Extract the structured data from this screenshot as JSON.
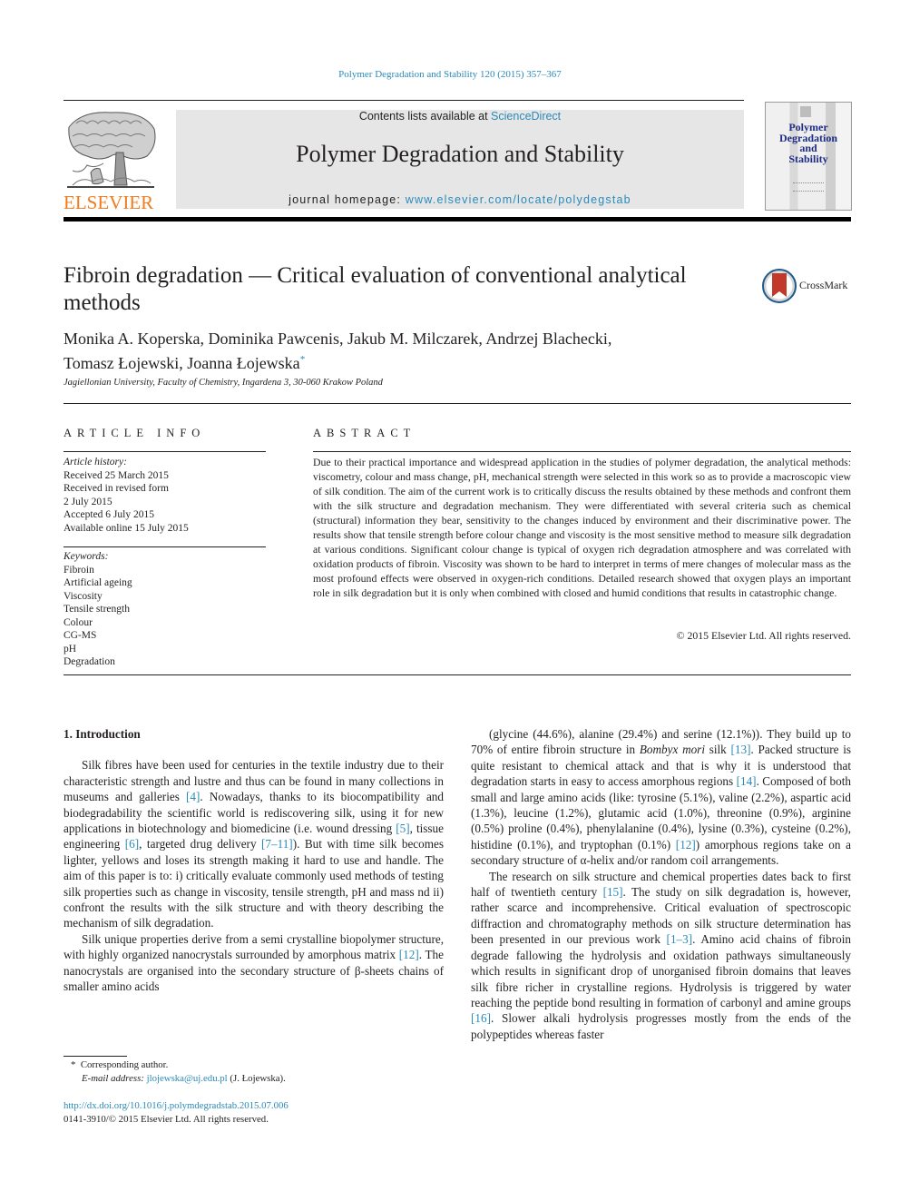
{
  "header": {
    "citation": "Polymer Degradation and Stability 120 (2015) 357–367",
    "publisher_logo_text": "ELSEVIER",
    "contents_prefix": "Contents lists available at ",
    "contents_link": "ScienceDirect",
    "journal_name": "Polymer Degradation and Stability",
    "homepage_prefix": "journal homepage: ",
    "homepage_link": "www.elsevier.com/locate/polydegstab",
    "cover_title": "Polymer\nDegradation\nand\nStability",
    "crossmark_label": "CrossMark"
  },
  "article": {
    "title": "Fibroin degradation — Critical evaluation of conventional analytical methods",
    "authors_line1": "Monika A. Koperska, Dominika Pawcenis, Jakub M. Milczarek, Andrzej Blachecki,",
    "authors_line2": "Tomasz Łojewski, Joanna Łojewska",
    "corresponding_mark": "*",
    "affiliation": "Jagiellonian University, Faculty of Chemistry, Ingardena 3, 30-060 Krakow Poland"
  },
  "article_info": {
    "heading": "ARTICLE INFO",
    "history_label": "Article history:",
    "history": [
      "Received 25 March 2015",
      "Received in revised form",
      "2 July 2015",
      "Accepted 6 July 2015",
      "Available online 15 July 2015"
    ],
    "keywords_label": "Keywords:",
    "keywords": [
      "Fibroin",
      "Artificial ageing",
      "Viscosity",
      "Tensile strength",
      "Colour",
      "CG-MS",
      "pH",
      "Degradation"
    ]
  },
  "abstract": {
    "heading": "ABSTRACT",
    "text": "Due to their practical importance and widespread application in the studies of polymer degradation, the analytical methods: viscometry, colour and mass change, pH, mechanical strength were selected in this work so as to provide a macroscopic view of silk condition. The aim of the current work is to critically discuss the results obtained by these methods and confront them with the silk structure and degradation mechanism. They were differentiated with several criteria such as chemical (structural) information they bear, sensitivity to the changes induced by environment and their discriminative power. The results show that tensile strength before colour change and viscosity is the most sensitive method to measure silk degradation at various conditions. Significant colour change is typical of oxygen rich degradation at­mosphere and was correlated with oxidation products of fibroin. Viscosity was shown to be hard to interpret in terms of mere changes of molecular mass as the most profound effects were observed in oxygen-rich conditions. Detailed research showed that oxygen plays an important role in silk degrada­tion but it is only when combined with closed and humid conditions that results in catastrophic change.",
    "copyright": "© 2015 Elsevier Ltd. All rights reserved."
  },
  "body": {
    "section_heading": "1.  Introduction",
    "left_paragraphs": [
      [
        {
          "t": "Silk fibres have been used for centuries in the textile industry due to their characteristic strength and lustre and thus can be found in many collections in museums and galleries "
        },
        {
          "ref": "[4]"
        },
        {
          "t": ". Nowadays, thanks to its biocompatibility and biodegradability the scientific world is rediscovering silk, using it for new applications in biotechnology and biomedicine (i.e. wound dressing "
        },
        {
          "ref": "[5]"
        },
        {
          "t": ", tissue engineering "
        },
        {
          "ref": "[6]"
        },
        {
          "t": ", targeted drug delivery "
        },
        {
          "ref": "[7–11]"
        },
        {
          "t": "). But with time silk becomes lighter, yellows and loses its strength making it hard to use and handle. The aim of this paper is to: i) critically evaluate commonly used methods of testing silk properties such as change in viscosity, tensile strength, pH and mass nd ii) confront the results with the silk structure and with theory describing the mechanism of silk degradation."
        }
      ],
      [
        {
          "t": "Silk unique properties derive from a semi crystalline biopolymer structure, with highly organized nanocrystals surrounded by amorphous matrix "
        },
        {
          "ref": "[12]"
        },
        {
          "t": ". The nanocrystals are organised into the secondary structure of β-sheets chains of smaller amino acids"
        }
      ]
    ],
    "right_paragraphs": [
      [
        {
          "t": "(glycine (44.6%), alanine (29.4%) and serine (12.1%)). They build up to 70% of entire fibroin structure in "
        },
        {
          "i": "Bombyx mori"
        },
        {
          "t": " silk "
        },
        {
          "ref": "[13]"
        },
        {
          "t": ". Packed structure is quite resistant to chemical attack and that is why it is understood that degradation starts in easy to access amorphous regions "
        },
        {
          "ref": "[14]"
        },
        {
          "t": ". Composed of both small and large amino acids (like: tyrosine (5.1%), valine (2.2%), aspartic acid (1.3%), leucine (1.2%), glutamic acid (1.0%), threonine (0.9%), arginine (0.5%) proline (0.4%), phenylalanine (0.4%), lysine (0.3%), cysteine (0.2%), histidine (0.1%), and tryptophan (0.1%) "
        },
        {
          "ref": "[12]"
        },
        {
          "t": ") amorphous regions take on a secondary structure of α-helix and/or random coil arrangements."
        }
      ],
      [
        {
          "t": "The research on silk structure and chemical properties dates back to first half of twentieth century "
        },
        {
          "ref": "[15]"
        },
        {
          "t": ". The study on silk degradation is, however, rather scarce and incomprehensive. Crit­ical evaluation of spectroscopic diffraction and chromatography methods on silk structure determination has been presented in our previous work "
        },
        {
          "ref": "[1–3]"
        },
        {
          "t": ". Amino acid chains of fibroin degrade fal­lowing the hydrolysis and oxidation pathways simultaneously which results in significant drop of unorganised fibroin domains that leaves silk fibre richer in crystalline regions. Hydrolysis is triggered by water reaching the peptide bond resulting in forma­tion of carbonyl and amine groups "
        },
        {
          "ref": "[16]"
        },
        {
          "t": ". Slower alkali hydrolysis progresses mostly from the ends of the polypeptides whereas faster"
        }
      ]
    ]
  },
  "footnote": {
    "mark": "*",
    "corresponding": "Corresponding author.",
    "email_label": "E-mail address:",
    "email": "jlojewska@uj.edu.pl",
    "email_suffix": "(J. Łojewska).",
    "doi": "http://dx.doi.org/10.1016/j.polymdegradstab.2015.07.006",
    "issn_line": "0141-3910/© 2015 Elsevier Ltd. All rights reserved."
  },
  "colors": {
    "link": "#2a8ab9",
    "elsevier_orange": "#f07c1f",
    "masthead_bg": "#e6e6e6",
    "cover_title": "#1e2c86",
    "crossmark_red": "#c0392b"
  }
}
